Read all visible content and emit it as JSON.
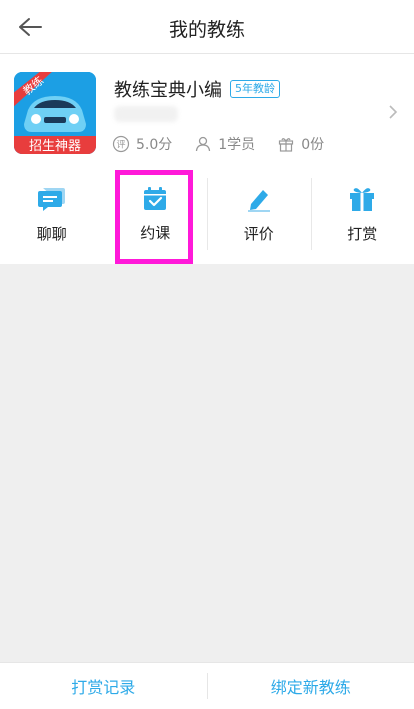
{
  "header": {
    "title": "我的教练"
  },
  "coach": {
    "avatar_text_top": "教练",
    "avatar_text_bottom": "招生神器",
    "name": "教练宝典小编",
    "badge": "5年教龄",
    "rating": "5.0分",
    "students": "1学员",
    "gifts": "0份"
  },
  "actions": [
    {
      "label": "聊聊",
      "icon": "chat-icon"
    },
    {
      "label": "约课",
      "icon": "calendar-check-icon"
    },
    {
      "label": "评价",
      "icon": "pencil-icon"
    },
    {
      "label": "打赏",
      "icon": "gift-icon"
    }
  ],
  "footer": {
    "left": "打赏记录",
    "right": "绑定新教练"
  },
  "colors": {
    "accent": "#2eaae8",
    "highlight": "#ff19d9"
  }
}
